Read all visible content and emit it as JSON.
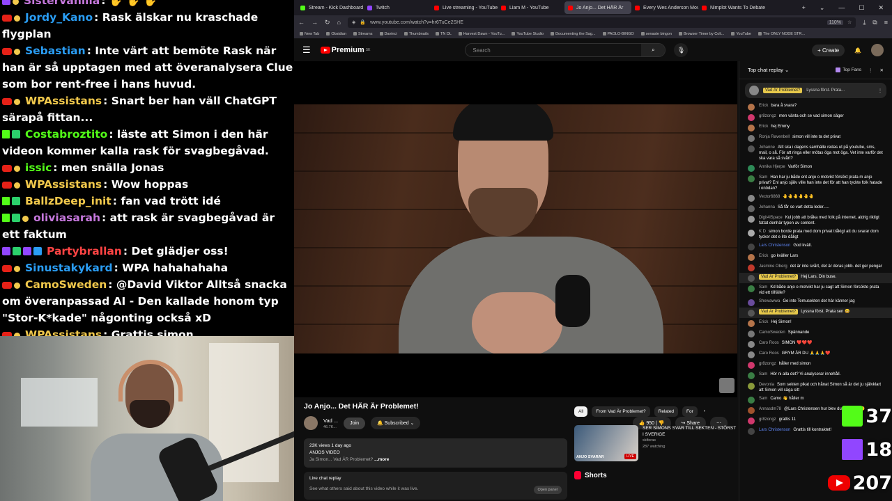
{
  "stream_chat": [
    {
      "badges": [
        "tw",
        "gold"
      ],
      "user": "Sistervanilla",
      "color": "#c678dd",
      "text": ": ✋ ✋ ✋"
    },
    {
      "badges": [
        "yt",
        "gold"
      ],
      "user": "Jordy_Kano",
      "color": "#2a9df4",
      "text": ": Rask älskar nu kraschade flygplan"
    },
    {
      "badges": [
        "yt",
        "gold"
      ],
      "user": "Sebastian",
      "color": "#2a9df4",
      "text": ": Inte värt att bemöte Rask när han är så upptagen med att överanalysera Clue som bor rent-free i hans huvud."
    },
    {
      "badges": [
        "yt",
        "gold"
      ],
      "user": "WPAssistans",
      "color": "#f2c94c",
      "text": ": Snart ber han väll ChatGPT särapå fittan..."
    },
    {
      "badges": [
        "k",
        "green"
      ],
      "user": "Costabroztito",
      "color": "#53fc18",
      "text": ": läste att Simon i den här videon kommer kalla rask för svagbegåvad."
    },
    {
      "badges": [
        "yt",
        "gold"
      ],
      "user": "issic",
      "color": "#53fc18",
      "text": ": men snälla Jonas"
    },
    {
      "badges": [
        "yt",
        "gold"
      ],
      "user": "WPAssistans",
      "color": "#f2c94c",
      "text": ": Wow hoppas"
    },
    {
      "badges": [
        "k",
        "green"
      ],
      "user": "BallzDeep_init",
      "color": "#f2c94c",
      "text": ": fan vad trött idé"
    },
    {
      "badges": [
        "k",
        "green",
        "gold"
      ],
      "user": "oliviasarah",
      "color": "#c678dd",
      "text": ": att rask är svagbegåvad är ett faktum"
    },
    {
      "badges": [
        "tw",
        "green",
        "tw",
        "blue"
      ],
      "user": "Partybrallan",
      "color": "#ff4444",
      "text": ": Det glädjer oss!"
    },
    {
      "badges": [
        "yt",
        "gold"
      ],
      "user": "Sinustakykard",
      "color": "#2a9df4",
      "text": ": WPA hahahahaha"
    },
    {
      "badges": [
        "yt",
        "gold"
      ],
      "user": "CamoSweden",
      "color": "#f2c94c",
      "text": ": @David Viktor Alltså snacka om överanpassad AI - Den kallade honom typ \"Stor-K*kade\" någonting också xD"
    },
    {
      "badges": [
        "yt",
        "gold"
      ],
      "user": "WPAssistans",
      "color": "#f2c94c",
      "text": ": Grattis simon"
    }
  ],
  "browser": {
    "tabs": [
      {
        "label": "Stream - Kick Dashboard",
        "color": "#53fc18"
      },
      {
        "label": "Twitch",
        "color": "#9146ff"
      },
      {
        "label": "Live streaming - YouTube",
        "color": "#f00"
      },
      {
        "label": "Liam M - YouTube",
        "color": "#f00"
      },
      {
        "label": "Jo Anjo... Det HÄR Är",
        "color": "#f00",
        "active": true
      },
      {
        "label": "Every Wes Anderson Mov",
        "color": "#f00"
      },
      {
        "label": "Nimplot Wants To Debate",
        "color": "#f00"
      }
    ],
    "url": "www.youtube.com/watch?v=hr6TuCe2SHE",
    "zoom": "110%",
    "bookmarks": [
      "New Tab",
      "Obsidian",
      "Streams",
      "Davinci",
      "Thumbnails",
      "TN DL",
      "Harvest Dawn - YouTu...",
      "YouTube Studio",
      "Documenting the Sag...",
      "PAOLO-BINGO",
      "senaste bingon",
      "Browser Timer by Coli...",
      "YouTube",
      "The ONLY NODE STR..."
    ]
  },
  "youtube": {
    "logo_text": "Premium",
    "logo_sup": "SE",
    "search_placeholder": "Search",
    "create_label": "Create",
    "video_title": "Jo Anjo... Det HÄR Är Problemet!",
    "channel_name": "Vad ...",
    "channel_subs": "46.7K...",
    "join_label": "Join",
    "subscribed_label": "Subscribed",
    "likes": "950",
    "share_label": "Share",
    "views_date": "23K views  1 day ago",
    "desc_line1": "ANJOS VIDEO",
    "desc_line2": "Ja Simon... Vad ÄR Problemet?",
    "more_label": "...more",
    "live_replay_title": "Live chat replay",
    "live_replay_sub": "See what others said about this video while it was live.",
    "open_panel": "Open panel",
    "chips": [
      "All",
      "From Vad Är Problemet?",
      "Related",
      "For"
    ],
    "rec_title": "SER SIMONS SVAR TILL SEKTEN - STÖRST I SVERIGE",
    "rec_channel": "skiferas",
    "rec_watching": "287 watching",
    "rec_thumb_label": "ANJO SVARAR",
    "rec_live": "LIVE",
    "shorts_label": "Shorts"
  },
  "live_chat": {
    "header": "Top chat replay",
    "top_fans": "Top Fans",
    "pinned_tag": "Vad Är Problemet?",
    "pinned_text": "Lyssna först. Prata...",
    "messages": [
      {
        "name": "Erick",
        "text": "bara å svara?",
        "av": "#b5744a"
      },
      {
        "name": "gr8zongz",
        "text": "men vänta och se vad simon säger",
        "av": "#d1386d"
      },
      {
        "name": "Erick",
        "text": "hej Emmy",
        "av": "#b5744a"
      },
      {
        "name": "Ronja Ravenbell",
        "text": "simon vill inte ta det privat",
        "av": "#777"
      },
      {
        "name": "Johanne",
        "text": "Allt ska i dagens samhälle redas ut på youtube, sms, mail, o så. För att ringa eller mötas öga mot öga. Vet inte varför det ska vara så svårt?",
        "av": "#555"
      },
      {
        "name": "Annika Hjerpe",
        "text": "Varför Simon",
        "av": "#2e8b57"
      },
      {
        "name": "Sam",
        "text": "Han har ju både ent anjo o motvikt försökt prata m anjo privat? Enl anjo själv ville han inte det för att han tyckte folk hatade i onödan?",
        "av": "#3a7d44"
      },
      {
        "name": "Vector6868",
        "text": "🤚🤚🤚🤚🤚🤚",
        "av": "#888"
      },
      {
        "name": "Johanna",
        "text": "Så får se vart detta leder.....",
        "av": "#666"
      },
      {
        "name": "Digit4lSpace",
        "text": "Kul jobb att bråka med folk på internet, aldrig riktigt fattat denhär typen av content.",
        "av": "#999"
      },
      {
        "name": "K D",
        "text": "simon borde prata med dom privat tråkigt att du svarar dom tycker det e lite dåligt",
        "av": "#aaa"
      },
      {
        "name": "Lars Christenson",
        "text": "God kväll.",
        "av": "#444",
        "mod": true
      },
      {
        "name": "Erick",
        "text": "go kväller Lars",
        "av": "#b5744a"
      },
      {
        "name": "Jasmine Oberg",
        "text": "det är inte svårt, det är deras jobb. det ger pengar",
        "av": "#c0392b"
      },
      {
        "name": "Vad Är Problemet?",
        "text": "Hej Lars. Din buse.",
        "av": "#555",
        "tag": true
      },
      {
        "name": "Sam",
        "text": "Kd både anjo o motvikt har ju sagt att Simon försökte prata vid ett tillfälle?",
        "av": "#3a7d44"
      },
      {
        "name": "Shewawwa",
        "text": "Ge inte Temusekten det här känner jag",
        "av": "#6a4c9c"
      },
      {
        "name": "Vad Är Problemet?",
        "text": "Lyssna först. Prata sen 😄",
        "av": "#555",
        "tag": true
      },
      {
        "name": "Erick",
        "text": "Hej Simon!",
        "av": "#b5744a"
      },
      {
        "name": "CamoSweden",
        "text": "Spännande",
        "av": "#777"
      },
      {
        "name": "Caro Roos",
        "text": "SIMON ❤️❤️❤️",
        "av": "#888"
      },
      {
        "name": "Caro Roos",
        "text": "GRYM ÄR DU 🙏🙏🙏❤️",
        "av": "#888"
      },
      {
        "name": "gr8zongz",
        "text": "håller med simon",
        "av": "#d1386d"
      },
      {
        "name": "Sam",
        "text": "Hör ni alla det? Vi analyserar innehåll.",
        "av": "#3a7d44"
      },
      {
        "name": "Devonia",
        "text": "Som sekten pikat och hånat Simon så är det ju självklart att Simon vill säga sitt",
        "av": "#8a9a3a"
      },
      {
        "name": "Sam",
        "text": "Camo 👋 håller m",
        "av": "#3a7d44"
      },
      {
        "name": "Annasdm78",
        "text": "@Lars Christensen hur blev du modd ❤️🙂",
        "av": "#a0522d"
      },
      {
        "name": "gr8zongz",
        "text": "grattis 11",
        "av": "#d1386d"
      },
      {
        "name": "Lars Christenson",
        "text": "Grattis till kontraktet!",
        "av": "#444",
        "mod": true
      }
    ]
  },
  "counters": {
    "kick": "37",
    "twitch": "18",
    "youtube": "207"
  }
}
